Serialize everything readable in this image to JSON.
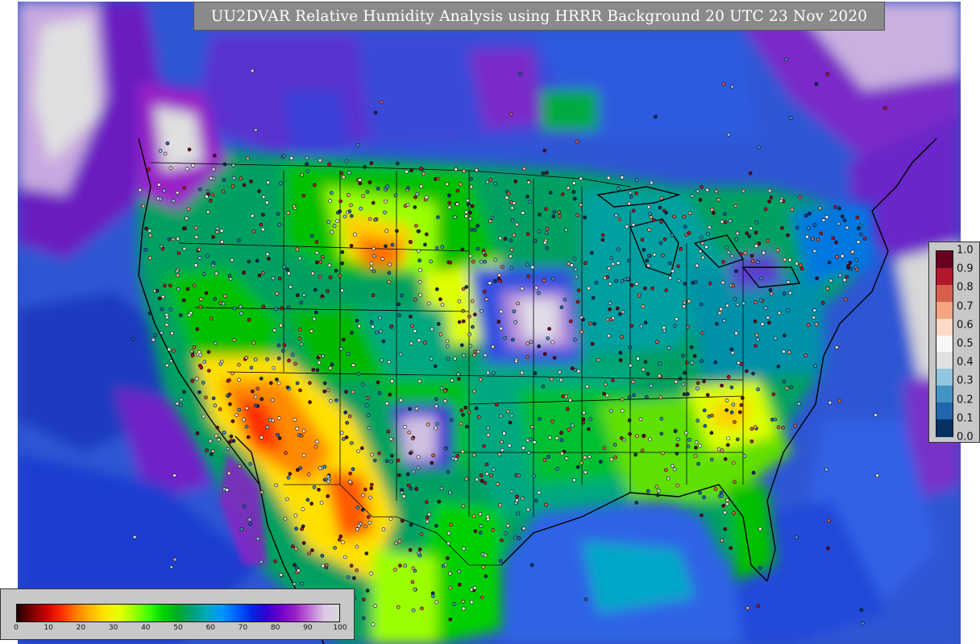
{
  "title": "UU2DVAR Relative Humidity Analysis using HRRR Background 20 UTC 23 Nov 2020",
  "rh_colorbar": {
    "ticks": [
      "0",
      "10",
      "20",
      "30",
      "40",
      "50",
      "60",
      "70",
      "80",
      "90",
      "100"
    ],
    "colors": [
      "#1a0000",
      "#7a0000",
      "#c80000",
      "#ff2a00",
      "#ff7a00",
      "#ffb400",
      "#ffe600",
      "#e6ff00",
      "#9cff00",
      "#3cff00",
      "#00d200",
      "#00aa28",
      "#00a07a",
      "#00a8c0",
      "#0096ff",
      "#0060ff",
      "#0028e6",
      "#3000d0",
      "#6e00c8",
      "#9a20c8",
      "#c070d8",
      "#dcc8e6",
      "#d8d8d8"
    ]
  },
  "obs_colorbar": {
    "ticks": [
      "1.0",
      "0.9",
      "0.8",
      "0.7",
      "0.6",
      "0.5",
      "0.4",
      "0.3",
      "0.2",
      "0.1",
      "0.0"
    ],
    "colors": [
      "#67001f",
      "#b2182b",
      "#d6604d",
      "#f4a582",
      "#fddbc7",
      "#f7f7f7",
      "#e0e0e0",
      "#92c5de",
      "#4393c3",
      "#2166ac",
      "#053061"
    ]
  }
}
